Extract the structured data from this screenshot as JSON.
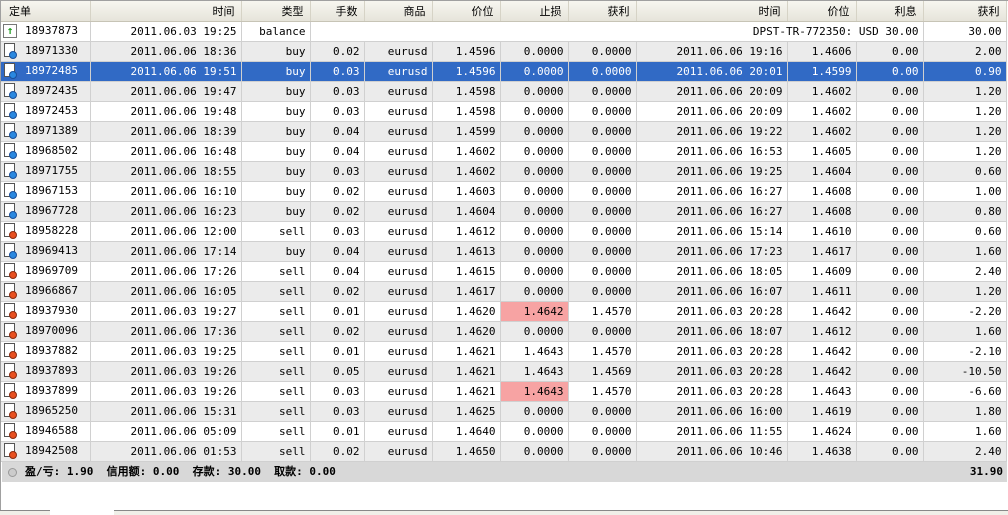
{
  "columns": [
    "定单",
    "时间",
    "类型",
    "手数",
    "商品",
    "价位",
    "止损",
    "获利",
    "时间",
    "价位",
    "利息",
    "获利"
  ],
  "balance_row": {
    "order": "18937873",
    "time": "2011.06.03 19:25",
    "type": "balance",
    "comment": "DPST-TR-772350: USD 30.00",
    "profit": "30.00"
  },
  "rows": [
    [
      "18971330",
      "2011.06.06 18:36",
      "buy",
      "0.02",
      "eurusd",
      "1.4596",
      "0.0000",
      "0.0000",
      "2011.06.06 19:16",
      "1.4606",
      "0.00",
      "2.00"
    ],
    [
      "18972485",
      "2011.06.06 19:51",
      "buy",
      "0.03",
      "eurusd",
      "1.4596",
      "0.0000",
      "0.0000",
      "2011.06.06 20:01",
      "1.4599",
      "0.00",
      "0.90"
    ],
    [
      "18972435",
      "2011.06.06 19:47",
      "buy",
      "0.03",
      "eurusd",
      "1.4598",
      "0.0000",
      "0.0000",
      "2011.06.06 20:09",
      "1.4602",
      "0.00",
      "1.20"
    ],
    [
      "18972453",
      "2011.06.06 19:48",
      "buy",
      "0.03",
      "eurusd",
      "1.4598",
      "0.0000",
      "0.0000",
      "2011.06.06 20:09",
      "1.4602",
      "0.00",
      "1.20"
    ],
    [
      "18971389",
      "2011.06.06 18:39",
      "buy",
      "0.04",
      "eurusd",
      "1.4599",
      "0.0000",
      "0.0000",
      "2011.06.06 19:22",
      "1.4602",
      "0.00",
      "1.20"
    ],
    [
      "18968502",
      "2011.06.06 16:48",
      "buy",
      "0.04",
      "eurusd",
      "1.4602",
      "0.0000",
      "0.0000",
      "2011.06.06 16:53",
      "1.4605",
      "0.00",
      "1.20"
    ],
    [
      "18971755",
      "2011.06.06 18:55",
      "buy",
      "0.03",
      "eurusd",
      "1.4602",
      "0.0000",
      "0.0000",
      "2011.06.06 19:25",
      "1.4604",
      "0.00",
      "0.60"
    ],
    [
      "18967153",
      "2011.06.06 16:10",
      "buy",
      "0.02",
      "eurusd",
      "1.4603",
      "0.0000",
      "0.0000",
      "2011.06.06 16:27",
      "1.4608",
      "0.00",
      "1.00"
    ],
    [
      "18967728",
      "2011.06.06 16:23",
      "buy",
      "0.02",
      "eurusd",
      "1.4604",
      "0.0000",
      "0.0000",
      "2011.06.06 16:27",
      "1.4608",
      "0.00",
      "0.80"
    ],
    [
      "18958228",
      "2011.06.06 12:00",
      "sell",
      "0.03",
      "eurusd",
      "1.4612",
      "0.0000",
      "0.0000",
      "2011.06.06 15:14",
      "1.4610",
      "0.00",
      "0.60"
    ],
    [
      "18969413",
      "2011.06.06 17:14",
      "buy",
      "0.04",
      "eurusd",
      "1.4613",
      "0.0000",
      "0.0000",
      "2011.06.06 17:23",
      "1.4617",
      "0.00",
      "1.60"
    ],
    [
      "18969709",
      "2011.06.06 17:26",
      "sell",
      "0.04",
      "eurusd",
      "1.4615",
      "0.0000",
      "0.0000",
      "2011.06.06 18:05",
      "1.4609",
      "0.00",
      "2.40"
    ],
    [
      "18966867",
      "2011.06.06 16:05",
      "sell",
      "0.02",
      "eurusd",
      "1.4617",
      "0.0000",
      "0.0000",
      "2011.06.06 16:07",
      "1.4611",
      "0.00",
      "1.20"
    ],
    [
      "18937930",
      "2011.06.03 19:27",
      "sell",
      "0.01",
      "eurusd",
      "1.4620",
      "1.4642",
      "1.4570",
      "2011.06.03 20:28",
      "1.4642",
      "0.00",
      "-2.20"
    ],
    [
      "18970096",
      "2011.06.06 17:36",
      "sell",
      "0.02",
      "eurusd",
      "1.4620",
      "0.0000",
      "0.0000",
      "2011.06.06 18:07",
      "1.4612",
      "0.00",
      "1.60"
    ],
    [
      "18937882",
      "2011.06.03 19:25",
      "sell",
      "0.01",
      "eurusd",
      "1.4621",
      "1.4643",
      "1.4570",
      "2011.06.03 20:28",
      "1.4642",
      "0.00",
      "-2.10"
    ],
    [
      "18937893",
      "2011.06.03 19:26",
      "sell",
      "0.05",
      "eurusd",
      "1.4621",
      "1.4643",
      "1.4569",
      "2011.06.03 20:28",
      "1.4642",
      "0.00",
      "-10.50"
    ],
    [
      "18937899",
      "2011.06.03 19:26",
      "sell",
      "0.03",
      "eurusd",
      "1.4621",
      "1.4643",
      "1.4570",
      "2011.06.03 20:28",
      "1.4643",
      "0.00",
      "-6.60"
    ],
    [
      "18965250",
      "2011.06.06 15:31",
      "sell",
      "0.03",
      "eurusd",
      "1.4625",
      "0.0000",
      "0.0000",
      "2011.06.06 16:00",
      "1.4619",
      "0.00",
      "1.80"
    ],
    [
      "18946588",
      "2011.06.06 05:09",
      "sell",
      "0.01",
      "eurusd",
      "1.4640",
      "0.0000",
      "0.0000",
      "2011.06.06 11:55",
      "1.4624",
      "0.00",
      "1.60"
    ],
    [
      "18942508",
      "2011.06.06 01:53",
      "sell",
      "0.02",
      "eurusd",
      "1.4650",
      "0.0000",
      "0.0000",
      "2011.06.06 10:46",
      "1.4638",
      "0.00",
      "2.40"
    ]
  ],
  "selected_order": "18972485",
  "highlighted_sl_orders": [
    "18937930",
    "18937899"
  ],
  "summary": {
    "text": "盈/亏: 1.90  信用额: 0.00  存款: 30.00  取款: 0.00",
    "total": "31.90"
  },
  "colors": {
    "selected": "#316ac5",
    "stop_hit": "#f7a3a3",
    "buy": "#2a88e0",
    "sell": "#e85020"
  }
}
